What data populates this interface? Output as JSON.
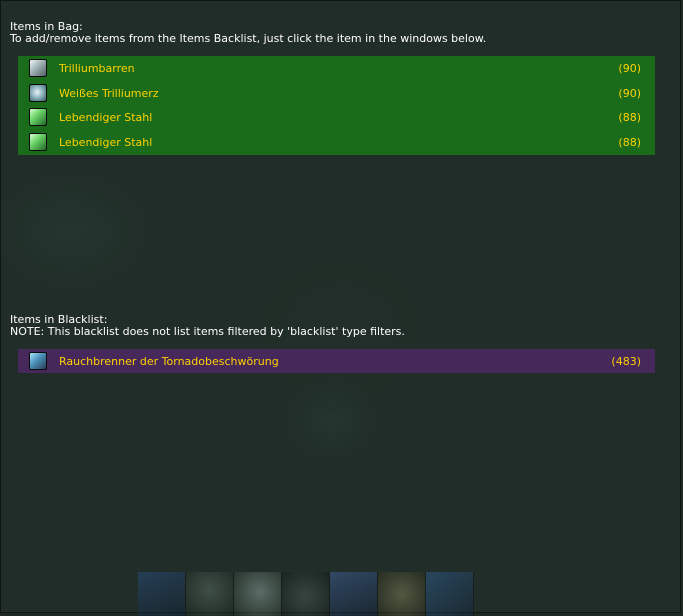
{
  "bag": {
    "title": "Items in Bag:",
    "instruction": "To add/remove items from the Items Backlist, just click the item in the windows below.",
    "items": [
      {
        "name": "Trilliumbarren",
        "count": "(90)",
        "icon": "metal-bar-icon"
      },
      {
        "name": "Weißes Trilliumerz",
        "count": "(90)",
        "icon": "ore-icon"
      },
      {
        "name": "Lebendiger Stahl",
        "count": "(88)",
        "icon": "living-steel-icon"
      },
      {
        "name": "Lebendiger Stahl",
        "count": "(88)",
        "icon": "living-steel-icon"
      }
    ]
  },
  "blacklist": {
    "title": "Items in Blacklist:",
    "note": "NOTE: This blacklist does not list items filtered by 'blacklist' type filters.",
    "items": [
      {
        "name": "Rauchbrenner der Tornadobeschwörung",
        "count": "(483)",
        "icon": "staff-icon"
      }
    ]
  },
  "colors": {
    "bag_panel": "#1a6b1a",
    "blacklist_panel": "#47285a",
    "item_text": "#ffd100",
    "heading_text": "#ffffff",
    "background": "#212d28"
  },
  "action_bar": {
    "slots": [
      "spell-icon-1",
      "spell-icon-2",
      "spell-icon-3",
      "spell-icon-4",
      "spell-icon-5",
      "spell-icon-6",
      "spell-icon-7"
    ]
  }
}
